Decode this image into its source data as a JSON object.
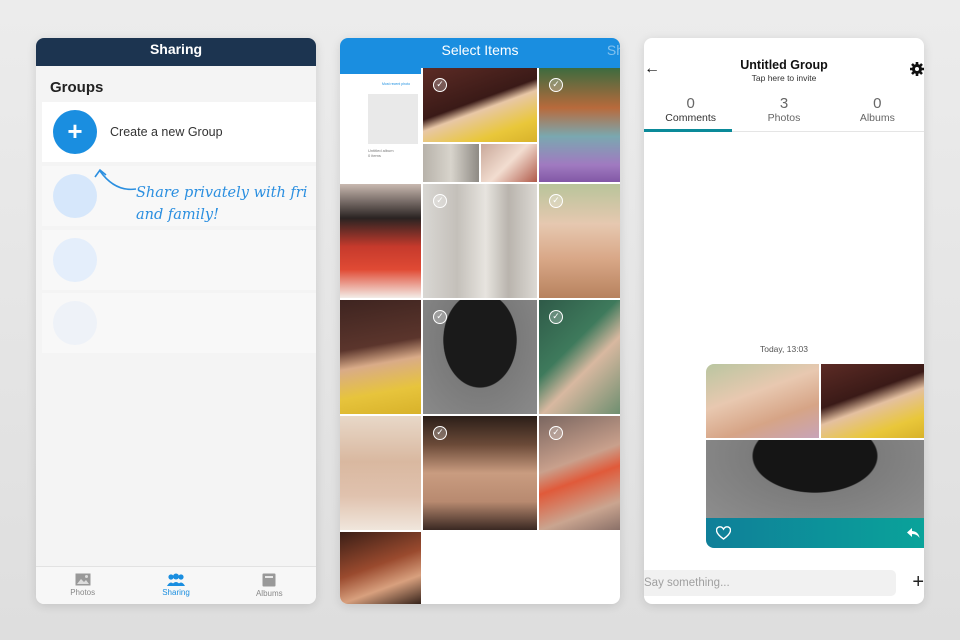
{
  "sharing_screen": {
    "title": "Sharing",
    "section_title": "Groups",
    "create_label": "Create a new Group",
    "hint_line1": "Share privately with fri",
    "hint_line2": "and family!",
    "tabs": [
      {
        "label": "Photos",
        "icon": "photos-icon",
        "active": false
      },
      {
        "label": "Sharing",
        "icon": "people-icon",
        "active": true
      },
      {
        "label": "Albums",
        "icon": "albums-icon",
        "active": false
      }
    ],
    "accent_color": "#1a8ee0",
    "header_color": "#1c3450"
  },
  "select_screen": {
    "title": "Select Items",
    "cut_off_action": "Sh",
    "mini_screenshot": {
      "link": "Most recent photo",
      "album_name": "Untitled album",
      "album_meta": "0 items"
    }
  },
  "group_screen": {
    "title": "Untitled Group",
    "subtitle": "Tap here to invite",
    "tabs": [
      {
        "count": "0",
        "label": "Comments",
        "active": true
      },
      {
        "count": "3",
        "label": "Photos",
        "active": false
      },
      {
        "count": "0",
        "label": "Albums",
        "active": false
      }
    ],
    "timestamp": "Today, 13:03",
    "input_placeholder": "Say something...",
    "add_symbol": "+",
    "accent_color": "#0a8a99"
  }
}
